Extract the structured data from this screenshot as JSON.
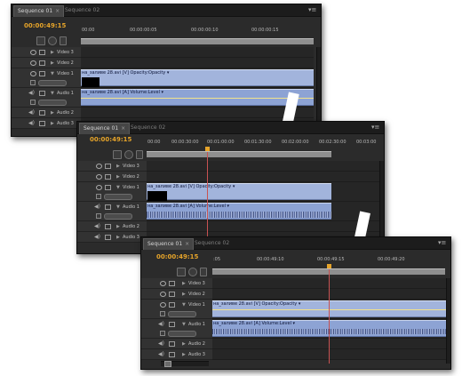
{
  "panels": [
    {
      "tabs": [
        {
          "label": "Sequence 01",
          "active": true
        },
        {
          "label": "Sequence 02",
          "active": false
        }
      ],
      "timecode": "00:00:49:15",
      "ruler": [
        "00:00",
        "00:00:00:05",
        "00:00:00:10",
        "00:00:00:15"
      ],
      "tracks": {
        "video3": "Video 3",
        "video2": "Video 2",
        "video1": "Video 1",
        "audio1": "Audio 1",
        "audio2": "Audio 2",
        "audio3": "Audio 3"
      },
      "clips": {
        "video": "на_заливе 28.avi [V] Opacity:Opacity ▾",
        "audio": "на_заливе 28.avi [A] Volume:Level ▾"
      }
    },
    {
      "tabs": [
        {
          "label": "Sequence 01",
          "active": true
        },
        {
          "label": "Sequence 02",
          "active": false
        }
      ],
      "timecode": "00:00:49:15",
      "ruler": [
        "00:00",
        "00:00:30:00",
        "00:01:00:00",
        "00:01:30:00",
        "00:02:00:00",
        "00:02:30:00",
        "00:03:00"
      ],
      "tracks": {
        "video3": "Video 3",
        "video2": "Video 2",
        "video1": "Video 1",
        "audio1": "Audio 1",
        "audio2": "Audio 2",
        "audio3": "Audio 3"
      },
      "clips": {
        "video": "на_заливе 28.avi [V] Opacity:Opacity ▾",
        "audio": "на_заливе 28.avi [A] Volume:Level ▾"
      }
    },
    {
      "tabs": [
        {
          "label": "Sequence 01",
          "active": true
        },
        {
          "label": "Sequence 02",
          "active": false
        }
      ],
      "timecode": "00:00:49:15",
      "ruler": [
        ":05",
        "00:00:49:10",
        "00:00:49:15",
        "00:00:49:20"
      ],
      "tracks": {
        "video3": "Video 3",
        "video2": "Video 2",
        "video1": "Video 1",
        "audio1": "Audio 1",
        "audio2": "Audio 2",
        "audio3": "Audio 3"
      },
      "clips": {
        "video": "на_заливе 28.avi [V] Opacity:Opacity ▾",
        "audio": "на_заливе 28.avi [A] Volume:Level ▾"
      }
    }
  ],
  "colors": {
    "timecode": "#e6a42a",
    "panel_bg": "#2b2b2b",
    "video_clip": "#a2b4dc",
    "audio_clip": "#8da3d4",
    "playhead": "#c85252"
  },
  "icons": [
    "snap-icon",
    "marker-icon",
    "eye-icon",
    "lock-icon",
    "speaker-icon",
    "expand-triangle-icon",
    "panel-menu-icon"
  ]
}
